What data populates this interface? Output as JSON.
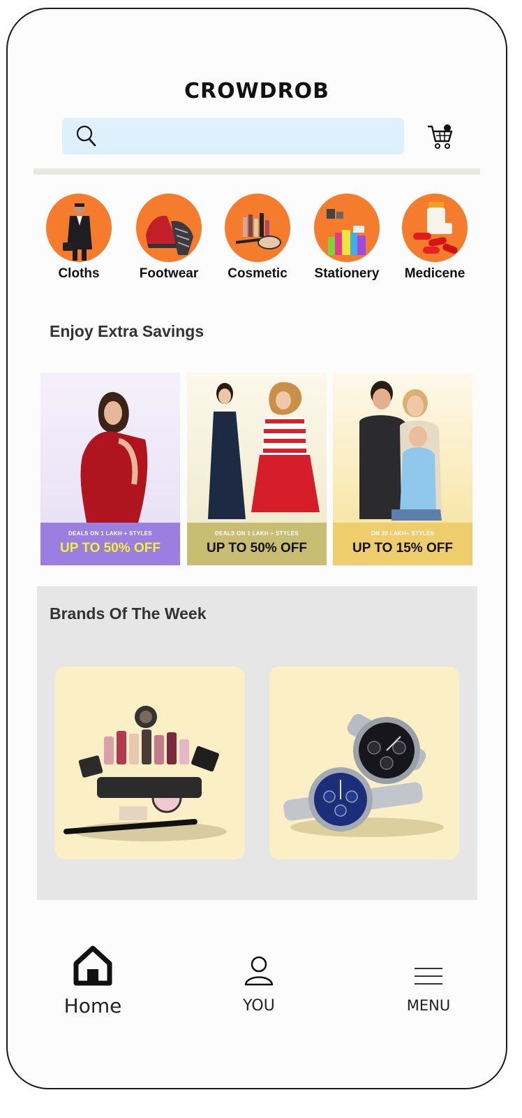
{
  "app": {
    "logo_text": "CROWDROB"
  },
  "search": {
    "placeholder": ""
  },
  "categories": [
    {
      "label": "Cloths",
      "icon": "person-in-suit-image"
    },
    {
      "label": "Footwear",
      "icon": "sneaker-image"
    },
    {
      "label": "Cosmetic",
      "icon": "makeup-image"
    },
    {
      "label": "Stationery",
      "icon": "stationery-image"
    },
    {
      "label": "Medicene",
      "icon": "pills-image"
    }
  ],
  "savings": {
    "title": "Enjoy Extra Savings",
    "promos": [
      {
        "small": "DEALS ON 1 LAKH + STYLES",
        "big": "UP TO 50% OFF",
        "band_color": "#9b7fe0",
        "big_color": "#f5ef3a",
        "small_color": "#ffffff"
      },
      {
        "small": "DEALS ON 1 LAKH + STYLES",
        "big": "UP TO 50% OFF",
        "band_color": "#c9bd74",
        "big_color": "#111111",
        "small_color": "#ffffff"
      },
      {
        "small": "ON  20 LAKH+ STYLES",
        "big": "UP TO 15% OFF",
        "band_color": "#eecd6c",
        "big_color": "#111111",
        "small_color": "#ffffff"
      }
    ]
  },
  "brands": {
    "title": "Brands Of The Week",
    "cards": [
      {
        "icon": "cosmetics-collection-image"
      },
      {
        "icon": "wrist-watches-image"
      }
    ]
  },
  "bottom_nav": [
    {
      "label": "Home",
      "icon": "home-icon"
    },
    {
      "label": "YOU",
      "icon": "user-icon"
    },
    {
      "label": "MENU",
      "icon": "menu-icon"
    }
  ],
  "colors": {
    "accent_orange": "#f47c2c",
    "search_bg": "#dff0fd",
    "brands_bg": "#e6e6e6",
    "card_bg": "#fbefc6"
  }
}
